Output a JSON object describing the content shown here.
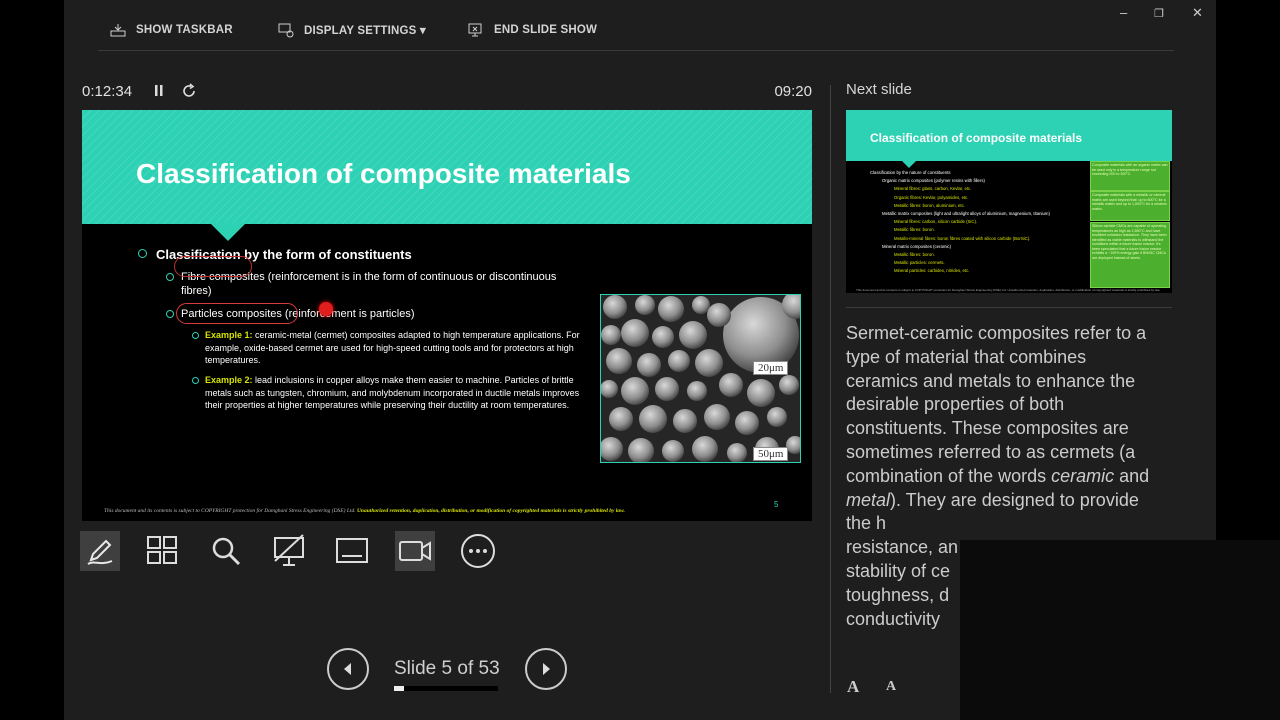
{
  "toolbar": {
    "show_taskbar": "SHOW TASKBAR",
    "display_settings": "DISPLAY SETTINGS ▾",
    "end_slide_show": "END SLIDE SHOW"
  },
  "window": {
    "minimize": "–",
    "restore": "❐",
    "close": "✕"
  },
  "presenter": {
    "elapsed_time": "0:12:34",
    "clock": "09:20"
  },
  "current_slide": {
    "title": "Classification of composite materials",
    "bullet_1": "Classification by the form of constituents",
    "fibre": "Fibre composites (reinforcement is in the form of continuous or discontinuous fibres)",
    "particles": "Particles composites (reinforcement is particles)",
    "ex1_label": "Example 1:",
    "ex1_text": " ceramic-metal (cermet) composites adapted to high temperature applications. For example, oxide-based cermet are used for high-speed cutting tools and for protectors at high temperatures.",
    "ex2_label": "Example 2:",
    "ex2_text": " lead inclusions in copper alloys make them easier to machine. Particles of brittle metals such as tungsten, chromium, and molybdenum incorporated in ductile metals improves their properties at higher temperatures while preserving their ductility at room temperatures.",
    "scale_top": "20μm",
    "scale_bottom": "50μm",
    "footer_main": "This document and its contents is subject to COPYRIGHT protection for Damghani Stress Engineering (DSE) Ltd. ",
    "footer_warn": "Unauthorized retention, duplication, distribution, or modification of copyrighted materials is strictly prohibited by law.",
    "page_number": "5"
  },
  "navigation": {
    "slide_counter": "Slide 5 of 53",
    "progress": 0.094
  },
  "next_slide": {
    "label": "Next slide",
    "title": "Classification of composite materials",
    "lines": [
      "Classification by the nature of constituents",
      "Organic matrix composites (polymer resins with fillers)",
      "Mineral fibres: glass, carbon, Kevlar, etc.",
      "Organic fibres: Kevlar, polyamides, etc.",
      "Metallic fibres: boron, aluminium, etc.",
      "Metallic matrix composites (light and ultralight alloys of aluminium, magnesium, titanium)",
      "Mineral fibres: carbon, silicon carbide (SiC).",
      "Metallic fibres: boron.",
      "Metallo-mineral fibres: boron fibres coated with silicon carbide (BorSiC).",
      "Mineral matrix composites (ceramic)",
      "Metallic fibres: boron.",
      "Metallic particles: cermets.",
      "Mineral particles: carbides, nitrides, etc."
    ],
    "box_1": "Composite materials with an organic matrix can be used only in a temperature range not exceeding 200 to 300°C.",
    "box_2": "Composite materials with a metallic or mineral matrix are used beyond that: up to 600°C for a metallic matrix and up to 1,000°C for a ceramic matrix.",
    "box_3": "Silicon carbide CMCs are capable of operating temperatures as high as 1,650°C and have excellent oxidation resistance. They have been identified as viable materials to withstand the conditions within a future fusion reactor. It's been speculated that a future fusion reactor exhibits a ~100% energy gain if BN/SiC CMCs are deployed instead of steels.",
    "footer": "This document and its contents is subject to COPYRIGHT protection for Damghani Stress Engineering (DSE) Ltd. Unauthorized retention, duplication, distribution, or modification of copyrighted materials is strictly prohibited by law."
  },
  "notes": {
    "part1": "Sermet-ceramic composites refer to a type of material that combines ceramics and metals to enhance the desirable properties of both constituents. These composites are sometimes referred to as cermets (a combination of the words ",
    "ceramic": "ceramic",
    "and": " and ",
    "metal": "metal",
    "part2": "). They are designed to provide the h",
    "line_resistance": "resistance, an",
    "line_stability": "stability of ce",
    "line_toughness": "toughness, d",
    "line_conductivity": "conductivity"
  },
  "font_controls": {
    "increase": "A",
    "decrease": "A"
  },
  "colors": {
    "accent": "#2dd1b4",
    "highlight": "#d7e400",
    "background": "#1e1e1e"
  },
  "icons": [
    "taskbar-icon",
    "display-settings-icon",
    "end-show-icon",
    "pause-icon",
    "restart-icon",
    "pen-icon",
    "see-all-slides-icon",
    "zoom-icon",
    "black-screen-icon",
    "subtitles-icon",
    "camera-icon",
    "more-options-icon",
    "previous-icon",
    "next-icon"
  ]
}
